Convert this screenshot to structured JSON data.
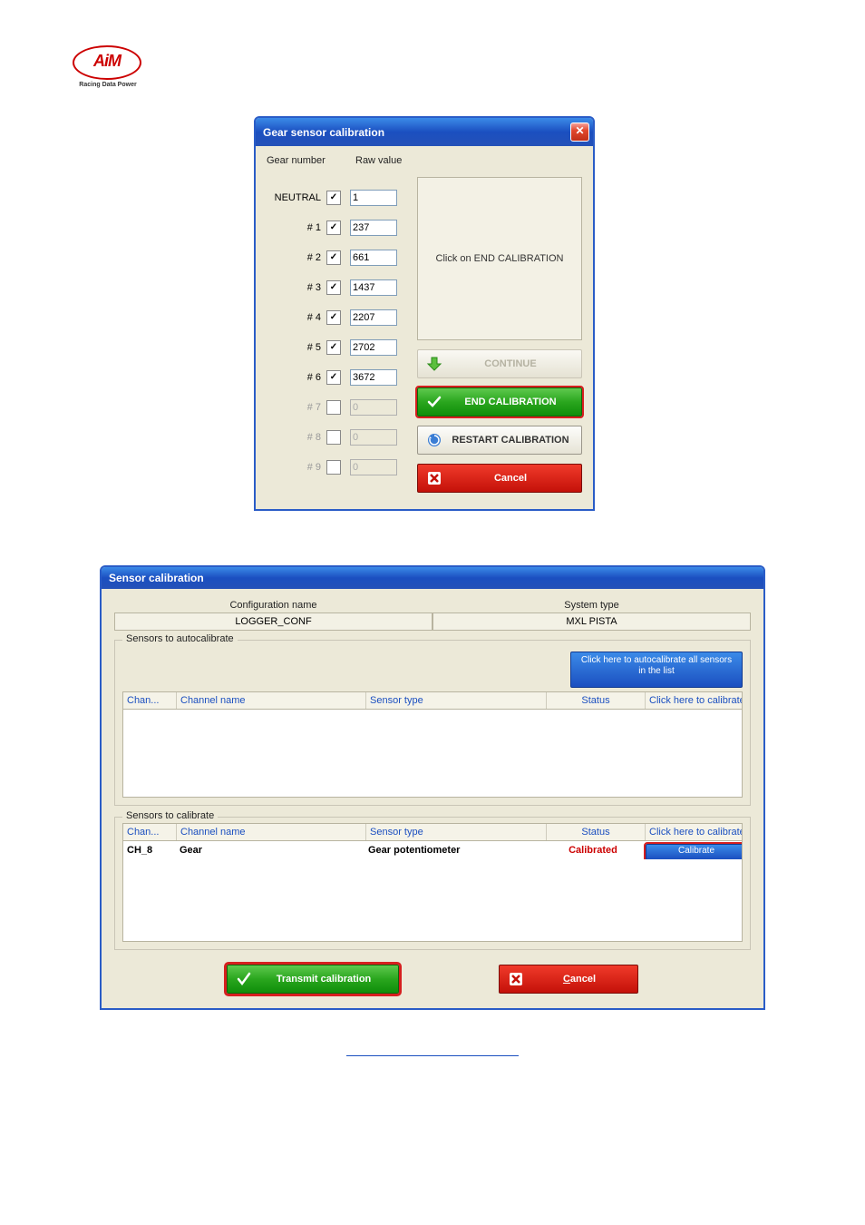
{
  "logo_text": "AiM",
  "logo_sub": "Racing Data Power",
  "dialog1": {
    "title": "Gear sensor calibration",
    "header_gear": "Gear number",
    "header_raw": "Raw value",
    "rows": [
      {
        "label": "NEUTRAL",
        "checked": true,
        "enabled": true,
        "value": "1"
      },
      {
        "label": "# 1",
        "checked": true,
        "enabled": true,
        "value": "237"
      },
      {
        "label": "# 2",
        "checked": true,
        "enabled": true,
        "value": "661"
      },
      {
        "label": "# 3",
        "checked": true,
        "enabled": true,
        "value": "1437"
      },
      {
        "label": "# 4",
        "checked": true,
        "enabled": true,
        "value": "2207"
      },
      {
        "label": "# 5",
        "checked": true,
        "enabled": true,
        "value": "2702"
      },
      {
        "label": "# 6",
        "checked": true,
        "enabled": true,
        "value": "3672"
      },
      {
        "label": "# 7",
        "checked": false,
        "enabled": false,
        "value": "0"
      },
      {
        "label": "# 8",
        "checked": false,
        "enabled": false,
        "value": "0"
      },
      {
        "label": "# 9",
        "checked": false,
        "enabled": false,
        "value": "0"
      }
    ],
    "message": "Click on END CALIBRATION",
    "btn_continue": "CONTINUE",
    "btn_end": "END CALIBRATION",
    "btn_restart": "RESTART CALIBRATION",
    "btn_cancel": "Cancel"
  },
  "dialog2": {
    "title": "Sensor calibration",
    "label_conf": "Configuration name",
    "label_sys": "System type",
    "value_conf": "LOGGER_CONF",
    "value_sys": "MXL PISTA",
    "fs_auto": "Sensors to autocalibrate",
    "fs_calib": "Sensors to calibrate",
    "btn_autocal": "Click here to autocalibrate all sensors  in the list",
    "col_chan": "Chan...",
    "col_name": "Channel name",
    "col_type": "Sensor type",
    "col_status": "Status",
    "col_action": "Click here to calibrate",
    "row": {
      "chan": "CH_8",
      "name": "Gear",
      "type": "Gear potentiometer",
      "status": "Calibrated",
      "button": "Calibrate"
    },
    "btn_transmit": "Transmit calibration",
    "btn_cancel_u": "C",
    "btn_cancel_rest": "ancel"
  }
}
